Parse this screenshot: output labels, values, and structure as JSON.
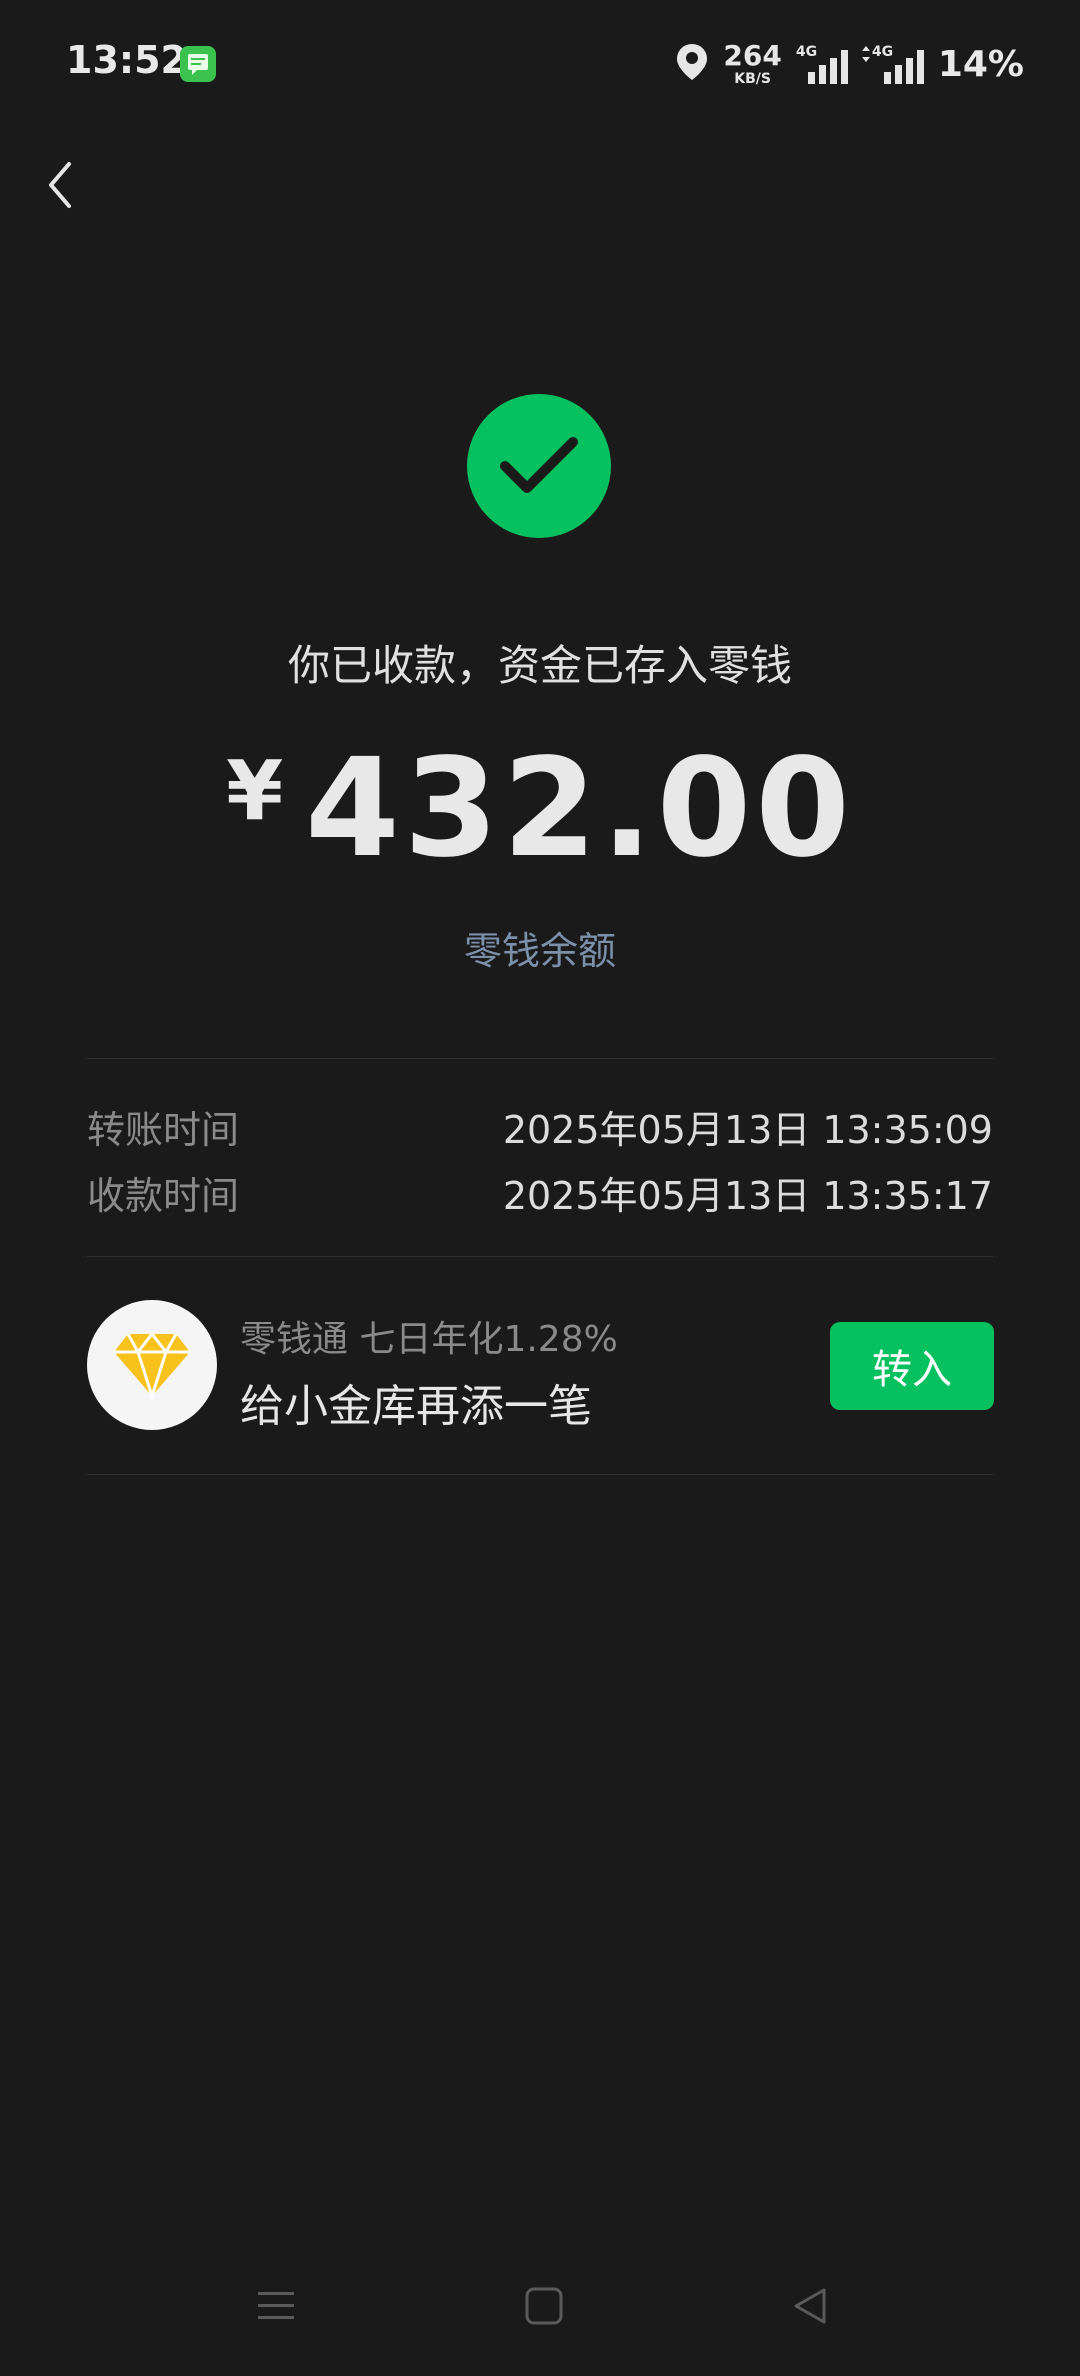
{
  "status_bar": {
    "time": "13:52",
    "net_speed_value": "264",
    "net_speed_unit": "KB/S",
    "signal1_label": "4G",
    "signal2_label": "4G",
    "battery": "14%"
  },
  "success": {
    "message": "你已收款，资金已存入零钱",
    "currency": "¥",
    "amount": "432.00",
    "balance_link": "零钱余额"
  },
  "details": [
    {
      "label": "转账时间",
      "value": "2025年05月13日 13:35:09"
    },
    {
      "label": "收款时间",
      "value": "2025年05月13日 13:35:17"
    }
  ],
  "promo": {
    "subtitle": "零钱通 七日年化1.28%",
    "title": "给小金库再添一笔",
    "button_label": "转入"
  },
  "colors": {
    "background": "#1a1a1a",
    "accent_green": "#07c160",
    "link_blue": "#7d90a9",
    "diamond_yellow": "#f7c21b"
  },
  "icons": {
    "back": "chevron-left-icon",
    "success": "checkmark-icon",
    "promo": "diamond-icon",
    "nav": [
      "menu-icon",
      "home-square-icon",
      "back-triangle-icon"
    ]
  }
}
